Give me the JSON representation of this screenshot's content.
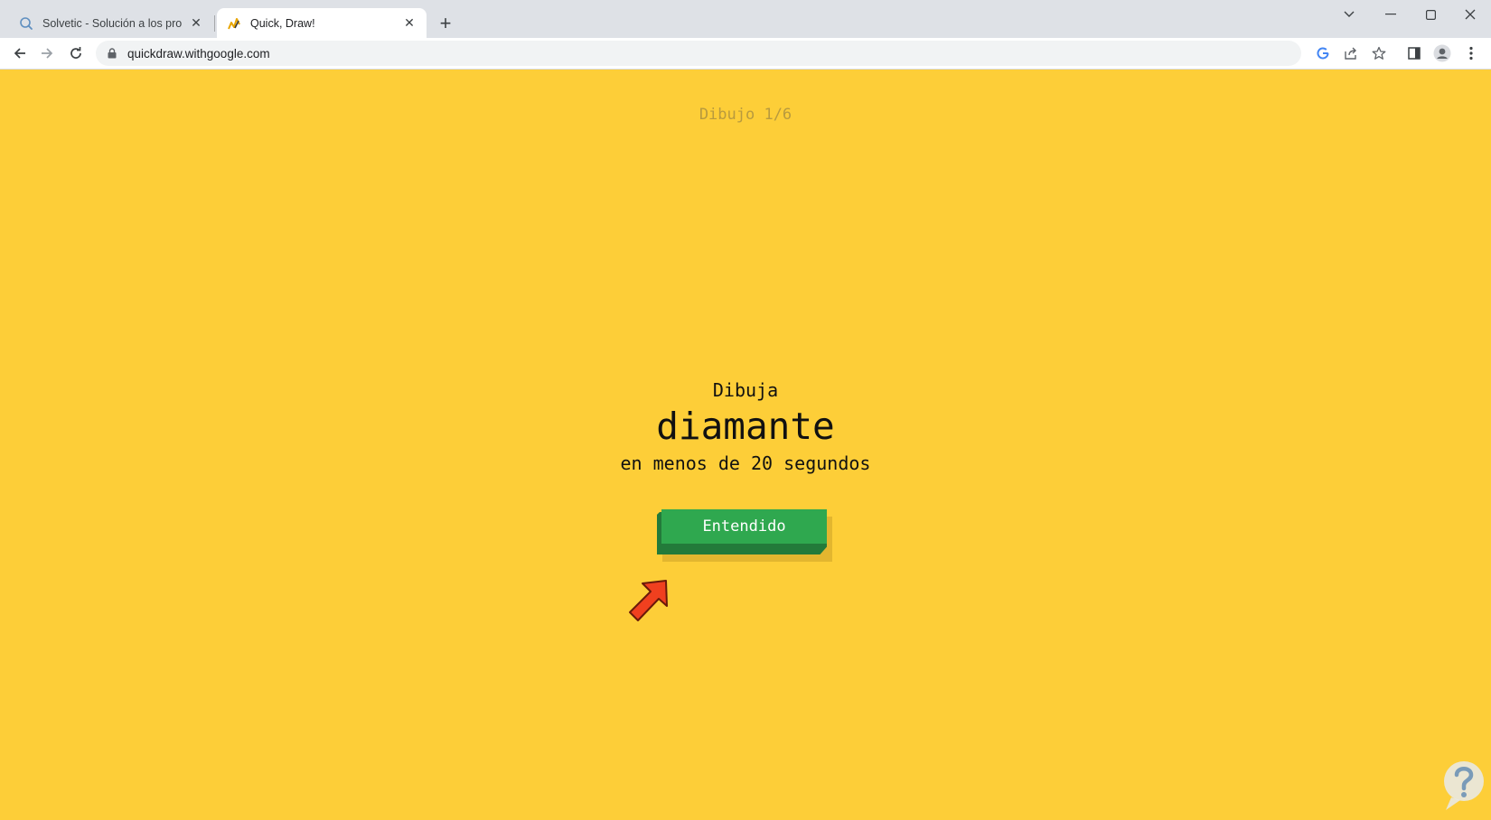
{
  "browser": {
    "tabs": [
      {
        "title": "Solvetic - Solución a los problem",
        "favicon": "search-bubble-icon",
        "active": false
      },
      {
        "title": "Quick, Draw!",
        "favicon": "quickdraw-pencil-icon",
        "active": true
      }
    ],
    "new_tab_label": "+",
    "address": "quickdraw.withgoogle.com"
  },
  "game": {
    "counter": "Dibujo 1/6",
    "prompt_pre": "Dibuja",
    "prompt_word": "diamante",
    "prompt_post": "en menos de 20 segundos",
    "button_label": "Entendido"
  },
  "colors": {
    "page_background": "#fdce38",
    "button_green": "#2fa84f",
    "button_depth": "#237a3a",
    "arrow_red": "#f0401f"
  }
}
